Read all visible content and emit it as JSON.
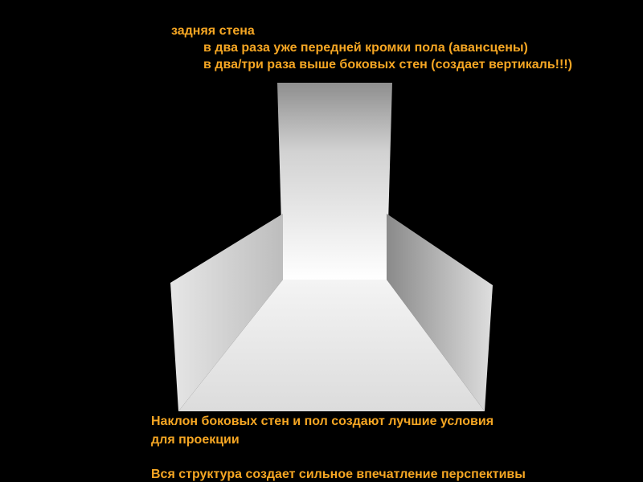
{
  "colors": {
    "background": "#000000",
    "caption_text": "#f5a623"
  },
  "captions": {
    "back_wall_title": "задняя стена",
    "back_wall_note_1": "в два раза уже передней кромки пола (авансцены)",
    "back_wall_note_2": "в два/три раза выше боковых стен (создает вертикаль!!!)",
    "slope_note_1": "Наклон боковых стен и пол создают лучшие условия",
    "slope_note_2": "для проекции",
    "perspective_note": "Вся структура создает сильное впечатление перспективы"
  }
}
